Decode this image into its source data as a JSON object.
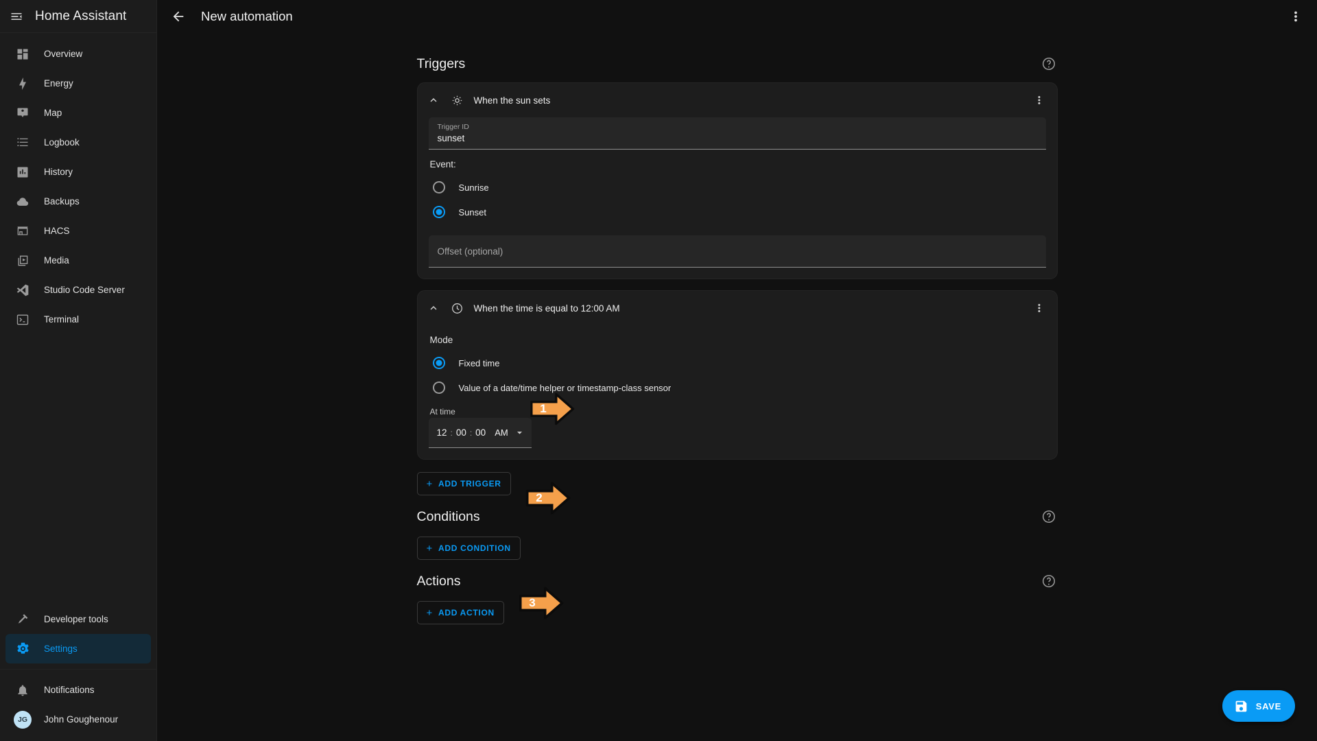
{
  "sidebar": {
    "title": "Home Assistant",
    "menu_icon": "menu-collapse-icon",
    "items": [
      {
        "label": "Overview",
        "icon": "view-dashboard-icon",
        "active": false
      },
      {
        "label": "Energy",
        "icon": "lightning-bolt-icon",
        "active": false
      },
      {
        "label": "Map",
        "icon": "map-marker-account-icon",
        "active": false
      },
      {
        "label": "Logbook",
        "icon": "format-list-bulleted-icon",
        "active": false
      },
      {
        "label": "History",
        "icon": "chart-box-icon",
        "active": false
      },
      {
        "label": "Backups",
        "icon": "cloud-icon",
        "active": false
      },
      {
        "label": "HACS",
        "icon": "hacs-store-icon",
        "active": false
      },
      {
        "label": "Media",
        "icon": "play-box-multiple-icon",
        "active": false
      },
      {
        "label": "Studio Code Server",
        "icon": "vscode-icon",
        "active": false
      },
      {
        "label": "Terminal",
        "icon": "console-icon",
        "active": false
      }
    ],
    "bottom_items": [
      {
        "label": "Developer tools",
        "icon": "hammer-icon",
        "active": false
      },
      {
        "label": "Settings",
        "icon": "cog-icon",
        "active": true
      }
    ],
    "footer_items": [
      {
        "label": "Notifications",
        "icon": "bell-icon"
      }
    ],
    "user": {
      "name": "John Goughenour",
      "initials": "JG"
    }
  },
  "topbar": {
    "back_icon": "arrow-left-icon",
    "title": "New automation",
    "more_icon": "dots-vertical-icon"
  },
  "sections": {
    "triggers": {
      "title": "Triggers",
      "help_icon": "help-circle-icon"
    },
    "conditions": {
      "title": "Conditions",
      "help_icon": "help-circle-icon"
    },
    "actions": {
      "title": "Actions",
      "help_icon": "help-circle-icon"
    }
  },
  "trigger_sun": {
    "collapse_icon": "chevron-up-icon",
    "type_icon": "weather-sunset-icon",
    "title": "When the sun sets",
    "more_icon": "dots-vertical-icon",
    "trigger_id": {
      "label": "Trigger ID",
      "value": "sunset"
    },
    "event_label": "Event:",
    "options": [
      {
        "label": "Sunrise",
        "checked": false
      },
      {
        "label": "Sunset",
        "checked": true
      }
    ],
    "offset": {
      "placeholder": "Offset (optional)",
      "value": ""
    }
  },
  "trigger_time": {
    "collapse_icon": "chevron-up-icon",
    "type_icon": "clock-outline-icon",
    "title": "When the time is equal to 12:00 AM",
    "more_icon": "dots-vertical-icon",
    "mode_label": "Mode",
    "options": [
      {
        "label": "Fixed time",
        "checked": true
      },
      {
        "label": "Value of a date/time helper or timestamp-class sensor",
        "checked": false
      }
    ],
    "at_time_label": "At time",
    "time": {
      "hour": "12",
      "minute": "00",
      "second": "00",
      "separator": ":",
      "meridiem": "AM",
      "dropdown_icon": "menu-down-icon"
    }
  },
  "buttons": {
    "add_trigger": "ADD TRIGGER",
    "add_condition": "ADD CONDITION",
    "add_action": "ADD ACTION",
    "plus": "+",
    "save": "SAVE",
    "save_icon": "content-save-icon"
  },
  "annotations": [
    {
      "number": "1",
      "target": "fixed-time-radio"
    },
    {
      "number": "2",
      "target": "at-time-field"
    },
    {
      "number": "3",
      "target": "add-condition-button"
    }
  ],
  "colors": {
    "accent": "#0a9bf5",
    "annotation": "#f5a04b",
    "background": "#111111",
    "card": "#1d1d1d",
    "sidebar": "#1c1c1c"
  }
}
